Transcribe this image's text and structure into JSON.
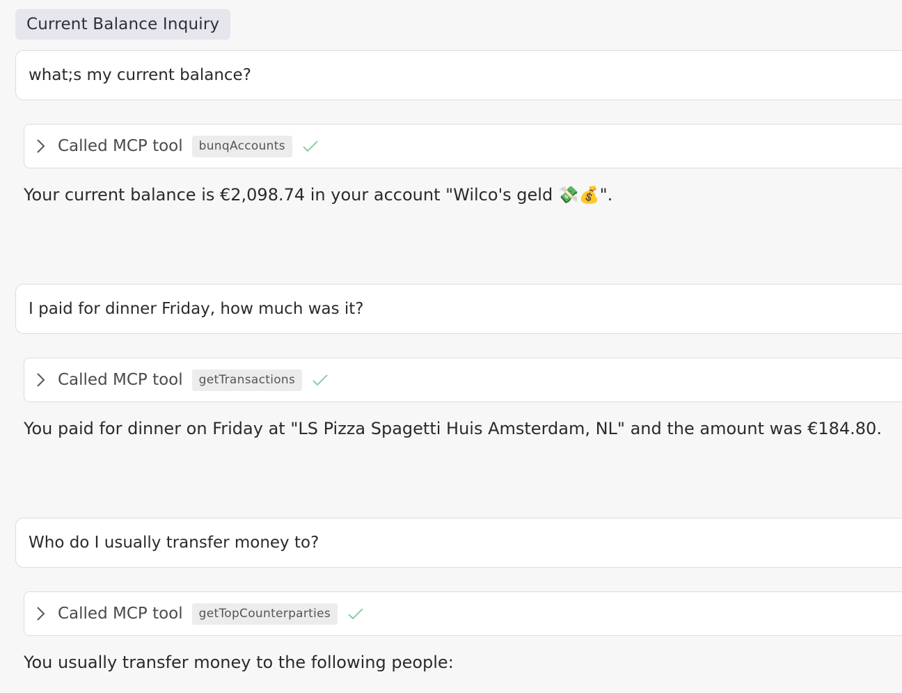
{
  "conversation": {
    "title": "Current Balance Inquiry",
    "turns": [
      {
        "user": "what;s my current balance?",
        "tool_prefix": "Called MCP tool",
        "tool_name": "bunqAccounts",
        "reply": "Your current balance is €2,098.74 in your account \"Wilco's geld 💸💰\"."
      },
      {
        "user": "I paid for dinner Friday, how much was it?",
        "tool_prefix": "Called MCP tool",
        "tool_name": "getTransactions",
        "reply": "You paid for dinner on Friday at \"LS Pizza Spagetti Huis Amsterdam, NL\" and the amount was €184.80."
      },
      {
        "user": "Who do I usually transfer money to?",
        "tool_prefix": "Called MCP tool",
        "tool_name": "getTopCounterparties",
        "reply": "You usually transfer money to the following people:"
      }
    ]
  },
  "icons": {
    "expand": "chevron-right-icon",
    "status": "checkmark-icon"
  },
  "colors": {
    "background": "#f7f7f7",
    "title_chip": "#e6e6ee",
    "card_border": "#dcdcdc",
    "check": "#7dc79a"
  }
}
